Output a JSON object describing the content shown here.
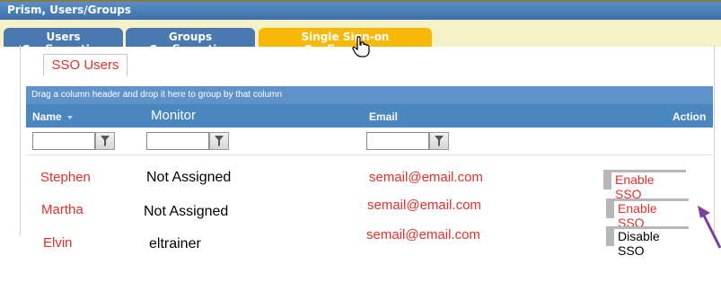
{
  "window": {
    "title": "Prism, Users/Groups"
  },
  "tabs": [
    {
      "label": "Users Configuration",
      "active": false
    },
    {
      "label": "Groups Configuration",
      "active": false
    },
    {
      "label": "Single Sign-on Configuration",
      "active": true
    }
  ],
  "subtab": {
    "label": "SSO Users"
  },
  "grid": {
    "group_hint": "Drag a column header and drop it here to group by that column",
    "columns": {
      "name": "Name",
      "monitor": "Monitor",
      "email": "Email",
      "action": "Action"
    },
    "rows": [
      {
        "name": "Stephen",
        "monitor": "Not Assigned",
        "email": "semail@email.com",
        "action": "Enable SSO"
      },
      {
        "name": "Martha",
        "monitor": "Not Assigned",
        "email": "semail@email.com",
        "action": "Enable SSO"
      },
      {
        "name": "Elvin",
        "monitor": "eltrainer",
        "email": "semail@email.com",
        "action": "Disable SSO"
      }
    ]
  },
  "colors": {
    "tab_active": "#f6b90a",
    "tab_inactive": "#4a79b2",
    "header": "#4a86c0",
    "link_red": "#e0302c",
    "annotation": "#7b3f9e"
  },
  "icons": {
    "sort": "sort-desc-icon",
    "filter": "funnel-icon",
    "cursor": "hand-pointer-icon",
    "annotation": "arrow-annotation-icon"
  }
}
